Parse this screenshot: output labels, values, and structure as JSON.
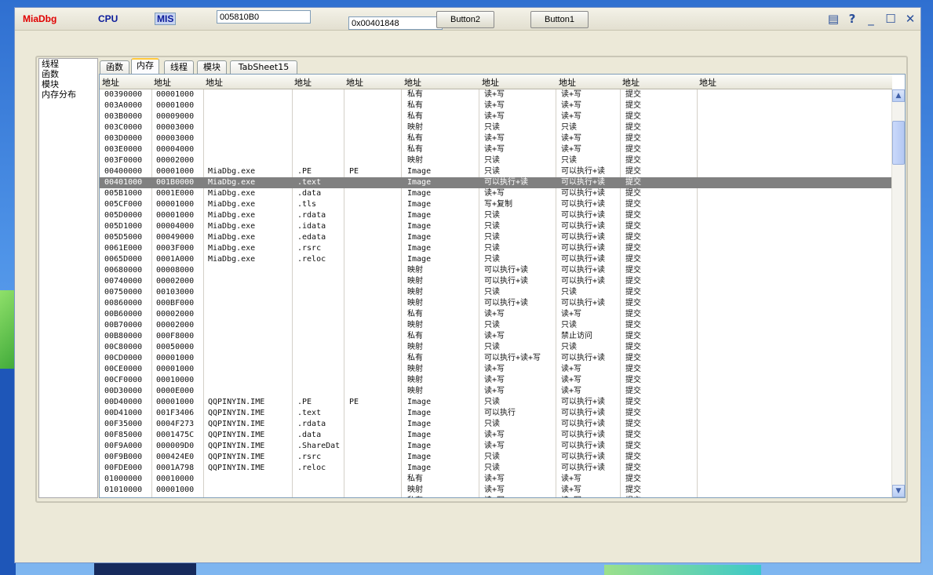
{
  "toolbar": {
    "brand": "MiaDbg",
    "cpu": "CPU",
    "mis": "MIS",
    "address_value": "005810B0",
    "address2_value": "0x00401848",
    "button2": "Button2",
    "button1": "Button1",
    "icons": [
      "list-icon",
      "help-icon",
      "minimize-icon",
      "maximize-icon",
      "close-icon"
    ],
    "colors": {
      "brand": "#e00000",
      "cpu": "#0a1a9a",
      "mis": "#0a1a9a"
    }
  },
  "sidenav": [
    "线程",
    "函数",
    "模块",
    "内存分布"
  ],
  "tabs": [
    "函数",
    "内存",
    "线程",
    "模块",
    "TabSheet15"
  ],
  "active_tab": "内存",
  "columns": [
    "地址",
    "地址",
    "地址",
    "地址",
    "地址",
    "地址",
    "地址",
    "地址",
    "地址",
    "地址"
  ],
  "selected_row": 8,
  "rows": [
    [
      "00390000",
      "00001000",
      "",
      "",
      "",
      "私有",
      "读+写",
      "读+写",
      "提交"
    ],
    [
      "003A0000",
      "00001000",
      "",
      "",
      "",
      "私有",
      "读+写",
      "读+写",
      "提交"
    ],
    [
      "003B0000",
      "00009000",
      "",
      "",
      "",
      "私有",
      "读+写",
      "读+写",
      "提交"
    ],
    [
      "003C0000",
      "00003000",
      "",
      "",
      "",
      "映射",
      "只读",
      "只读",
      "提交"
    ],
    [
      "003D0000",
      "00003000",
      "",
      "",
      "",
      "私有",
      "读+写",
      "读+写",
      "提交"
    ],
    [
      "003E0000",
      "00004000",
      "",
      "",
      "",
      "私有",
      "读+写",
      "读+写",
      "提交"
    ],
    [
      "003F0000",
      "00002000",
      "",
      "",
      "",
      "映射",
      "只读",
      "只读",
      "提交"
    ],
    [
      "00400000",
      "00001000",
      "MiaDbg.exe",
      ".PE",
      "PE",
      "Image",
      "只读",
      "可以执行+读",
      "提交"
    ],
    [
      "00401000",
      "001B0000",
      "MiaDbg.exe",
      ".text",
      "",
      "Image",
      "可以执行+读",
      "可以执行+读",
      "提交"
    ],
    [
      "005B1000",
      "0001E000",
      "MiaDbg.exe",
      ".data",
      "",
      "Image",
      "读+写",
      "可以执行+读",
      "提交"
    ],
    [
      "005CF000",
      "00001000",
      "MiaDbg.exe",
      ".tls",
      "",
      "Image",
      "写+复制",
      "可以执行+读",
      "提交"
    ],
    [
      "005D0000",
      "00001000",
      "MiaDbg.exe",
      ".rdata",
      "",
      "Image",
      "只读",
      "可以执行+读",
      "提交"
    ],
    [
      "005D1000",
      "00004000",
      "MiaDbg.exe",
      ".idata",
      "",
      "Image",
      "只读",
      "可以执行+读",
      "提交"
    ],
    [
      "005D5000",
      "00049000",
      "MiaDbg.exe",
      ".edata",
      "",
      "Image",
      "只读",
      "可以执行+读",
      "提交"
    ],
    [
      "0061E000",
      "0003F000",
      "MiaDbg.exe",
      ".rsrc",
      "",
      "Image",
      "只读",
      "可以执行+读",
      "提交"
    ],
    [
      "0065D000",
      "0001A000",
      "MiaDbg.exe",
      ".reloc",
      "",
      "Image",
      "只读",
      "可以执行+读",
      "提交"
    ],
    [
      "00680000",
      "00008000",
      "",
      "",
      "",
      "映射",
      "可以执行+读",
      "可以执行+读",
      "提交"
    ],
    [
      "00740000",
      "00002000",
      "",
      "",
      "",
      "映射",
      "可以执行+读",
      "可以执行+读",
      "提交"
    ],
    [
      "00750000",
      "00103000",
      "",
      "",
      "",
      "映射",
      "只读",
      "只读",
      "提交"
    ],
    [
      "00860000",
      "000BF000",
      "",
      "",
      "",
      "映射",
      "可以执行+读",
      "可以执行+读",
      "提交"
    ],
    [
      "00B60000",
      "00002000",
      "",
      "",
      "",
      "私有",
      "读+写",
      "读+写",
      "提交"
    ],
    [
      "00B70000",
      "00002000",
      "",
      "",
      "",
      "映射",
      "只读",
      "只读",
      "提交"
    ],
    [
      "00B80000",
      "000F8000",
      "",
      "",
      "",
      "私有",
      "读+写",
      "禁止访问",
      "提交"
    ],
    [
      "00C80000",
      "00050000",
      "",
      "",
      "",
      "映射",
      "只读",
      "只读",
      "提交"
    ],
    [
      "00CD0000",
      "00001000",
      "",
      "",
      "",
      "私有",
      "可以执行+读+写",
      "可以执行+读",
      "提交"
    ],
    [
      "00CE0000",
      "00001000",
      "",
      "",
      "",
      "映射",
      "读+写",
      "读+写",
      "提交"
    ],
    [
      "00CF0000",
      "00010000",
      "",
      "",
      "",
      "映射",
      "读+写",
      "读+写",
      "提交"
    ],
    [
      "00D30000",
      "0000E000",
      "",
      "",
      "",
      "映射",
      "读+写",
      "读+写",
      "提交"
    ],
    [
      "00D40000",
      "00001000",
      "QQPINYIN.IME",
      ".PE",
      "PE",
      "Image",
      "只读",
      "可以执行+读",
      "提交"
    ],
    [
      "00D41000",
      "001F3406",
      "QQPINYIN.IME",
      ".text",
      "",
      "Image",
      "可以执行",
      "可以执行+读",
      "提交"
    ],
    [
      "00F35000",
      "0004F273",
      "QQPINYIN.IME",
      ".rdata",
      "",
      "Image",
      "只读",
      "可以执行+读",
      "提交"
    ],
    [
      "00F85000",
      "0001475C",
      "QQPINYIN.IME",
      ".data",
      "",
      "Image",
      "读+写",
      "可以执行+读",
      "提交"
    ],
    [
      "00F9A000",
      "000009D0",
      "QQPINYIN.IME",
      ".ShareDat",
      "",
      "Image",
      "读+写",
      "可以执行+读",
      "提交"
    ],
    [
      "00F9B000",
      "000424E0",
      "QQPINYIN.IME",
      ".rsrc",
      "",
      "Image",
      "只读",
      "可以执行+读",
      "提交"
    ],
    [
      "00FDE000",
      "0001A798",
      "QQPINYIN.IME",
      ".reloc",
      "",
      "Image",
      "只读",
      "可以执行+读",
      "提交"
    ],
    [
      "01000000",
      "00010000",
      "",
      "",
      "",
      "私有",
      "读+写",
      "读+写",
      "提交"
    ],
    [
      "01010000",
      "00001000",
      "",
      "",
      "",
      "映射",
      "读+写",
      "读+写",
      "提交"
    ],
    [
      "",
      "",
      "",
      "",
      "",
      "私有",
      "读+写",
      "读+写",
      "提交"
    ]
  ]
}
